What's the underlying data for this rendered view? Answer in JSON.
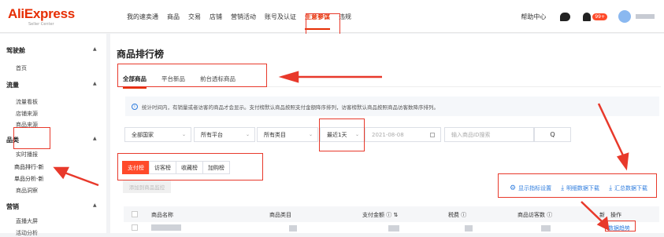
{
  "logo": {
    "brand": "AliExpress",
    "sub": "Seller Center"
  },
  "nav": [
    "我的速卖通",
    "商品",
    "交易",
    "店铺",
    "营销活动",
    "账号及认证",
    "生意参谋",
    "违规"
  ],
  "topbar": {
    "help": "帮助中心",
    "badge": "99+"
  },
  "sidebar": {
    "sections": [
      {
        "title": "驾驶舱",
        "items": [
          "首页"
        ]
      },
      {
        "title": "流量",
        "items": [
          "流量看板",
          "店铺来源",
          "商品来源"
        ]
      },
      {
        "title": "品类",
        "items": [
          "实时播报",
          "商品排行-新",
          "单品分析-新",
          "商品洞察"
        ]
      },
      {
        "title": "营销",
        "items": [
          "直播大屏",
          "活动分析"
        ]
      }
    ]
  },
  "main": {
    "title": "商品排行榜",
    "tabs": [
      "全部商品",
      "平台新品",
      "前台透标商品"
    ],
    "notice": "统计时间内，有销量或者访客的商品才会显示。支付榜默认商品按照支付金额降序排列，访客榜默认商品按照商品访客数降序排列。",
    "filters": {
      "country": "全部国家",
      "platform": "所有平台",
      "category": "所有类目",
      "period": "最近1天",
      "date": "2021-08-08",
      "search_placeholder": "输入商品ID搜索",
      "search_icon": "Q"
    },
    "segments": [
      "支付榜",
      "访客榜",
      "收藏榜",
      "加购榜"
    ],
    "add_button": "添加到商品监控",
    "actions": [
      "显示指标设置",
      "明细数据下载",
      "汇总数据下载"
    ],
    "table": {
      "headers": [
        "商品名称",
        "商品类目",
        "支付金额 ⓘ ⇅",
        "税费 ⓘ",
        "商品访客数 ⓘ",
        "新",
        "操作"
      ],
      "row_link": "数据趋势"
    }
  },
  "colors": {
    "accent": "#e62e04",
    "link": "#2f7dde",
    "annotation": "#e8392b"
  }
}
